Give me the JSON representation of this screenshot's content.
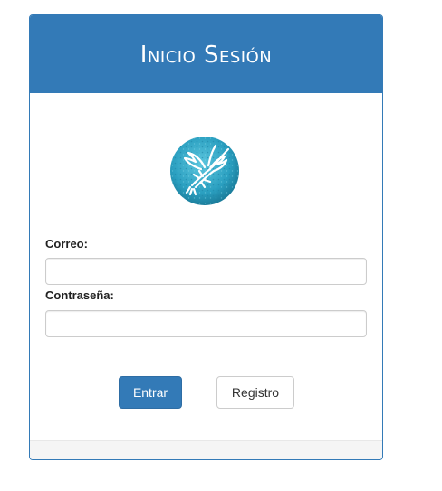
{
  "header": {
    "title": "Inicio Sesión"
  },
  "logo": {
    "icon": "lobster-logo-icon",
    "color": "#2aa0c0"
  },
  "form": {
    "email_label": "Correo:",
    "email_value": "",
    "password_label": "Contraseña:",
    "password_value": ""
  },
  "actions": {
    "submit_label": "Entrar",
    "register_label": "Registro"
  },
  "colors": {
    "primary": "#337ab7",
    "panel_border": "#337ab7",
    "input_border": "#cccccc"
  }
}
